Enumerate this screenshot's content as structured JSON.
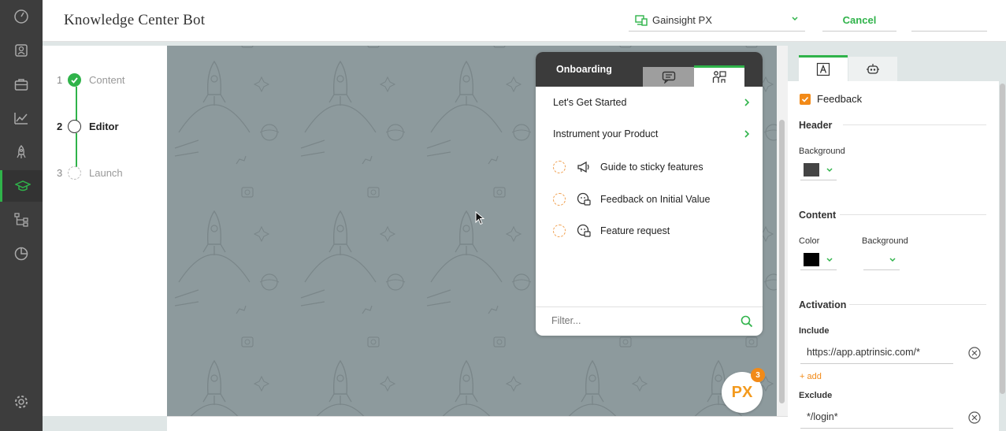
{
  "header": {
    "title": "Knowledge Center Bot",
    "product": "Gainsight PX",
    "cancel_label": "Cancel",
    "save_label": ""
  },
  "nav": {
    "items": [
      "dashboard-icon",
      "accounts-icon",
      "briefcase-icon",
      "analytics-icon",
      "rocket-icon",
      "graduation-cap-icon",
      "flow-icon",
      "pie-chart-icon",
      "settings-icon"
    ],
    "active": "graduation-cap-icon"
  },
  "steps": [
    {
      "num": "1",
      "label": "Content",
      "state": "done"
    },
    {
      "num": "2",
      "label": "Editor",
      "state": "current"
    },
    {
      "num": "3",
      "label": "Launch",
      "state": "todo"
    }
  ],
  "bot": {
    "title": "Onboarding",
    "items": [
      {
        "label": "Let's Get Started",
        "type": "category"
      },
      {
        "label": "Instrument your Product",
        "type": "category"
      },
      {
        "label": "Guide to sticky features",
        "type": "guide",
        "icon": "megaphone-icon"
      },
      {
        "label": "Feedback on Initial Value",
        "type": "guide",
        "icon": "feedback-icon"
      },
      {
        "label": "Feature request",
        "type": "guide",
        "icon": "feedback-icon"
      }
    ],
    "filter_placeholder": "Filter...",
    "badge_label": "PX",
    "badge_count": "3"
  },
  "properties": {
    "feedback_label": "Feedback",
    "feedback_checked": true,
    "header_section": "Header",
    "header_background_label": "Background",
    "header_background_color": "#444444",
    "content_section": "Content",
    "content_color_label": "Color",
    "content_color": "#000000",
    "content_background_label": "Background",
    "activation_section": "Activation",
    "include_label": "Include",
    "include_url": "https://app.aptrinsic.com/*",
    "add_label": "+ add",
    "exclude_label": "Exclude",
    "exclude_url": "*/login*"
  },
  "colors": {
    "accent": "#2fb34a",
    "orange": "#f28a18",
    "nav_bg": "#3d3d3d",
    "canvas_bg": "#8d9a9d"
  }
}
